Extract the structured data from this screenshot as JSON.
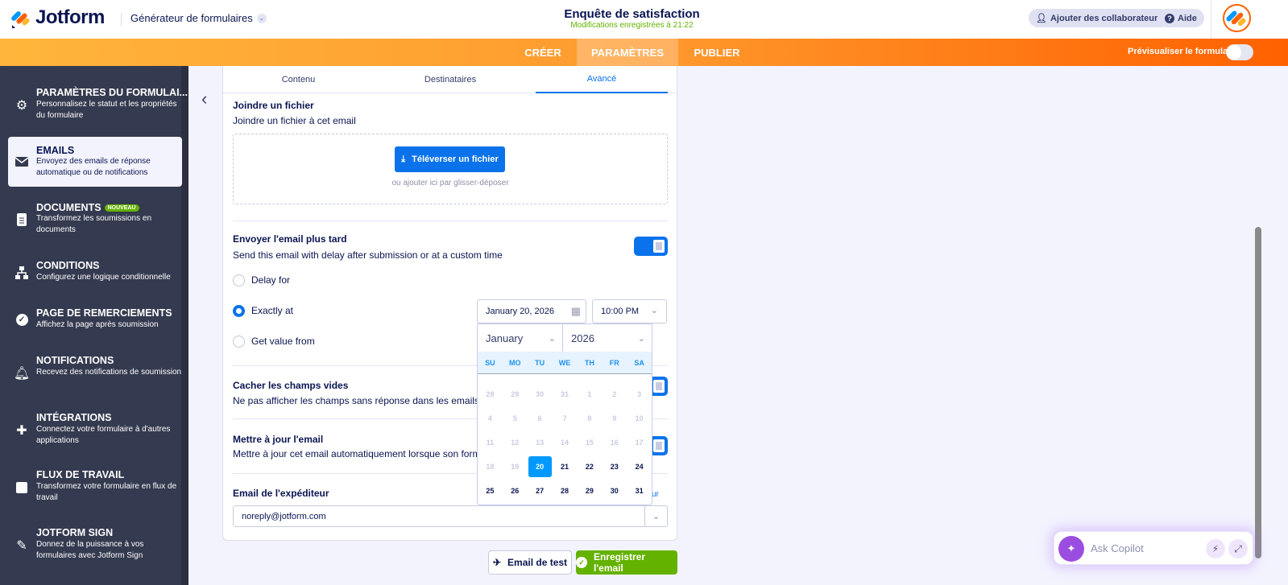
{
  "header": {
    "logo": "Jotform",
    "builder": "Générateur de formulaires",
    "form_title": "Enquête de satisfaction",
    "saved_status": "Modifications enregistrées à 21:22",
    "add_collaborators": "Ajouter des collaborateurs",
    "help": "Aide"
  },
  "nav": {
    "tabs": [
      {
        "label": "CRÉER"
      },
      {
        "label": "PARAMÈTRES",
        "active": true
      },
      {
        "label": "PUBLIER"
      }
    ],
    "preview_label": "Prévisualiser le formulaire",
    "preview_on": false
  },
  "sidebar": {
    "items": [
      {
        "title": "PARAMÈTRES DU FORMULAI...",
        "desc": "Personnalisez le statut et les propriétés du formulaire",
        "icon": "gear-icon"
      },
      {
        "title": "EMAILS",
        "desc": "Envoyez des emails de réponse automatique ou de notifications",
        "icon": "envelope-icon",
        "active": true
      },
      {
        "title": "DOCUMENTS",
        "badge": "NOUVEAU",
        "desc": "Transformez les soumissions en documents",
        "icon": "document-icon"
      },
      {
        "title": "CONDITIONS",
        "desc": "Configurez une logique conditionnelle",
        "icon": "sitemap-icon"
      },
      {
        "title": "PAGE DE REMERCIEMENTS",
        "desc": "Affichez la page après soumission",
        "icon": "check-circle-icon"
      },
      {
        "title": "NOTIFICATIONS",
        "desc": "Recevez des notifications de soumission",
        "icon": "bell-icon"
      },
      {
        "title": "INTÉGRATIONS",
        "desc": "Connectez votre formulaire à d'autres applications",
        "icon": "puzzle-icon"
      },
      {
        "title": "FLUX DE TRAVAIL",
        "desc": "Transformez votre formulaire en flux de travail",
        "icon": "workflow-icon"
      },
      {
        "title": "JOTFORM SIGN",
        "desc": "Donnez de la puissance à vos formulaires avec Jotform Sign",
        "icon": "pen-icon"
      }
    ]
  },
  "tabs": [
    {
      "label": "Contenu"
    },
    {
      "label": "Destinataires"
    },
    {
      "label": "Avancé",
      "active": true
    }
  ],
  "attach": {
    "title": "Joindre un fichier",
    "desc": "Joindre un fichier à cet email",
    "upload": "Téléverser un fichier",
    "drop_hint": "ou ajouter ici par glisser-déposer"
  },
  "send_later": {
    "title": "Envoyer l'email plus tard",
    "desc": "Send this email with delay after submission or at a custom time",
    "enabled": true,
    "options": [
      {
        "label": "Delay for",
        "checked": false
      },
      {
        "label": "Exactly at",
        "checked": true
      },
      {
        "label": "Get value from",
        "checked": false
      }
    ],
    "date": "January 20, 2026",
    "time": "10:00 PM"
  },
  "calendar": {
    "month": "January",
    "year": "2026",
    "weekdays": [
      "SU",
      "MO",
      "TU",
      "WE",
      "TH",
      "FR",
      "SA"
    ],
    "weeks": [
      [
        "28",
        "29",
        "30",
        "31",
        "1",
        "2",
        "3"
      ],
      [
        "4",
        "5",
        "6",
        "7",
        "8",
        "9",
        "10"
      ],
      [
        "11",
        "12",
        "13",
        "14",
        "15",
        "16",
        "17"
      ],
      [
        "18",
        "19",
        "20",
        "21",
        "22",
        "23",
        "24"
      ],
      [
        "25",
        "26",
        "27",
        "28",
        "29",
        "30",
        "31"
      ]
    ],
    "selected": "20"
  },
  "hide_empty": {
    "title": "Cacher les champs vides",
    "desc": "Ne pas afficher les champs sans réponse dans les emails"
  },
  "update_email": {
    "title": "Mettre à jour l'email",
    "desc": "Mettre à jour cet email automatiquement lorsque son form"
  },
  "sender": {
    "title": "Email de l'expéditeur",
    "link": "ur",
    "value": "noreply@jotform.com"
  },
  "footer": {
    "test": "Email de test",
    "save": "Enregistrer l'email"
  },
  "copilot": {
    "placeholder": "Ask Copilot"
  },
  "colors": {
    "accent": "#0a73eb",
    "orange": "#ff6100",
    "green": "#64b200",
    "sidebar": "#343a4f"
  }
}
